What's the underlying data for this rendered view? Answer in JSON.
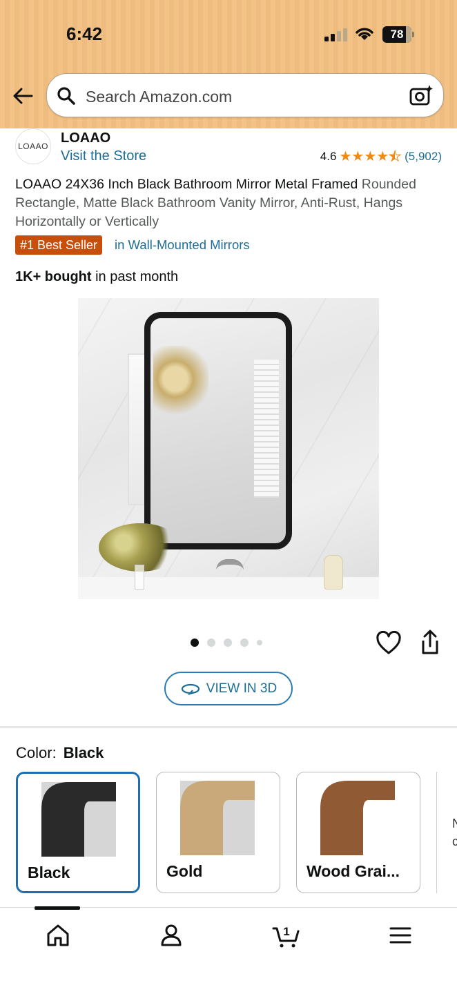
{
  "status_bar": {
    "time": "6:42",
    "battery": "78"
  },
  "search": {
    "placeholder": "Search Amazon.com"
  },
  "brand": {
    "logo_text": "LOAAO",
    "name": "LOAAO",
    "store_link": "Visit the Store"
  },
  "rating": {
    "value": "4.6",
    "count": "(5,902)",
    "stars": 4.5
  },
  "product": {
    "title_bold": "LOAAO 24X36 Inch Black Bathroom Mirror Metal Framed",
    "title_rest": "Rounded Rectangle, Matte Black Bathroom Vanity Mirror, Anti-Rust, Hangs Horizontally or Vertically",
    "badge": "#1 Best Seller",
    "badge_category": "in Wall-Mounted Mirrors",
    "bought_bold": "1K+ bought",
    "bought_rest": " in past month"
  },
  "gallery": {
    "image_count": 5,
    "active_index": 0,
    "view3d_label": "VIEW IN 3D"
  },
  "color": {
    "label": "Color:",
    "selected": "Black",
    "options": [
      {
        "label": "Black",
        "swatch": "#2a2a2a"
      },
      {
        "label": "Gold",
        "swatch": "#c9a97a"
      },
      {
        "label": "Wood Grai...",
        "swatch": "#8f5a34"
      }
    ],
    "more_text": "N c"
  },
  "bottom_nav": {
    "cart_count": "1",
    "items": [
      "home-icon",
      "account-icon",
      "cart-icon",
      "menu-icon"
    ]
  }
}
